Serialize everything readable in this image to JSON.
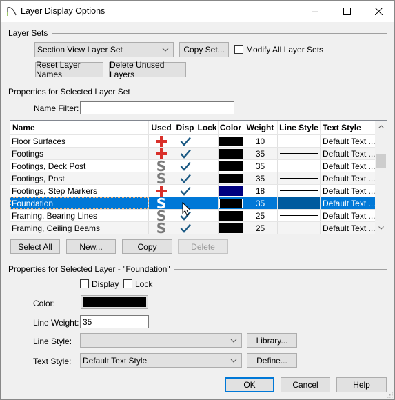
{
  "window": {
    "title": "Layer Display Options",
    "icon": "app-arc-icon",
    "controls": [
      "minimize",
      "maximize",
      "close"
    ]
  },
  "layer_sets": {
    "group_label": "Layer Sets",
    "selected_set": "Section View Layer Set",
    "copy_set_label": "Copy Set...",
    "modify_all_label": "Modify All Layer Sets",
    "modify_all_checked": false,
    "reset_names_label": "Reset Layer Names",
    "delete_unused_label": "Delete Unused Layers"
  },
  "set_properties": {
    "group_label": "Properties for Selected Layer Set",
    "name_filter_label": "Name Filter:",
    "name_filter_value": "",
    "table": {
      "columns": [
        "Name",
        "Used",
        "Disp",
        "Lock",
        "Color",
        "Weight",
        "Line Style",
        "Text Style"
      ],
      "sorted_by": "Name",
      "rows": [
        {
          "name": "Floor Surfaces",
          "used": "plus",
          "disp": true,
          "lock": false,
          "color": "#000000",
          "weight": "10",
          "line_style": "solid",
          "text_style": "Default Text ...",
          "selected": false
        },
        {
          "name": "Footings",
          "used": "plus",
          "disp": true,
          "lock": false,
          "color": "#000000",
          "weight": "35",
          "line_style": "solid",
          "text_style": "Default Text ...",
          "selected": false
        },
        {
          "name": "Footings, Deck Post",
          "used": "S",
          "disp": true,
          "lock": false,
          "color": "#000000",
          "weight": "35",
          "line_style": "solid",
          "text_style": "Default Text ...",
          "selected": false
        },
        {
          "name": "Footings, Post",
          "used": "S",
          "disp": true,
          "lock": false,
          "color": "#000000",
          "weight": "35",
          "line_style": "solid",
          "text_style": "Default Text ...",
          "selected": false
        },
        {
          "name": "Footings, Step Markers",
          "used": "plus",
          "disp": true,
          "lock": false,
          "color": "#000080",
          "weight": "18",
          "line_style": "solid",
          "text_style": "Default Text ...",
          "selected": false
        },
        {
          "name": "Foundation",
          "used": "S",
          "disp": false,
          "lock": false,
          "color": "#000000",
          "weight": "35",
          "line_style": "solid",
          "text_style": "Default Text ...",
          "selected": true
        },
        {
          "name": "Framing, Bearing Lines",
          "used": "S",
          "disp": true,
          "lock": false,
          "color": "#000000",
          "weight": "25",
          "line_style": "solid",
          "text_style": "Default Text ...",
          "selected": false
        },
        {
          "name": "Framing, Ceiling Beams",
          "used": "S",
          "disp": true,
          "lock": false,
          "color": "#000000",
          "weight": "25",
          "line_style": "solid",
          "text_style": "Default Text ...",
          "selected": false
        }
      ]
    },
    "buttons": {
      "select_all": "Select All",
      "new": "New...",
      "copy": "Copy",
      "delete": "Delete"
    }
  },
  "layer_properties": {
    "group_label": "Properties for Selected Layer - \"Foundation\"",
    "display_label": "Display",
    "display_checked": false,
    "lock_label": "Lock",
    "lock_checked": false,
    "color_label": "Color:",
    "color_value": "#000000",
    "line_weight_label": "Line Weight:",
    "line_weight_value": "35",
    "line_style_label": "Line Style:",
    "line_style_value": "solid",
    "library_label": "Library...",
    "text_style_label": "Text Style:",
    "text_style_value": "Default Text Style",
    "define_label": "Define..."
  },
  "footer": {
    "ok": "OK",
    "cancel": "Cancel",
    "help": "Help"
  },
  "colors": {
    "accent": "#0078d7",
    "used_plus": "#d9302a",
    "check": "#1c5a84",
    "used_s": "#7a7a7a"
  }
}
